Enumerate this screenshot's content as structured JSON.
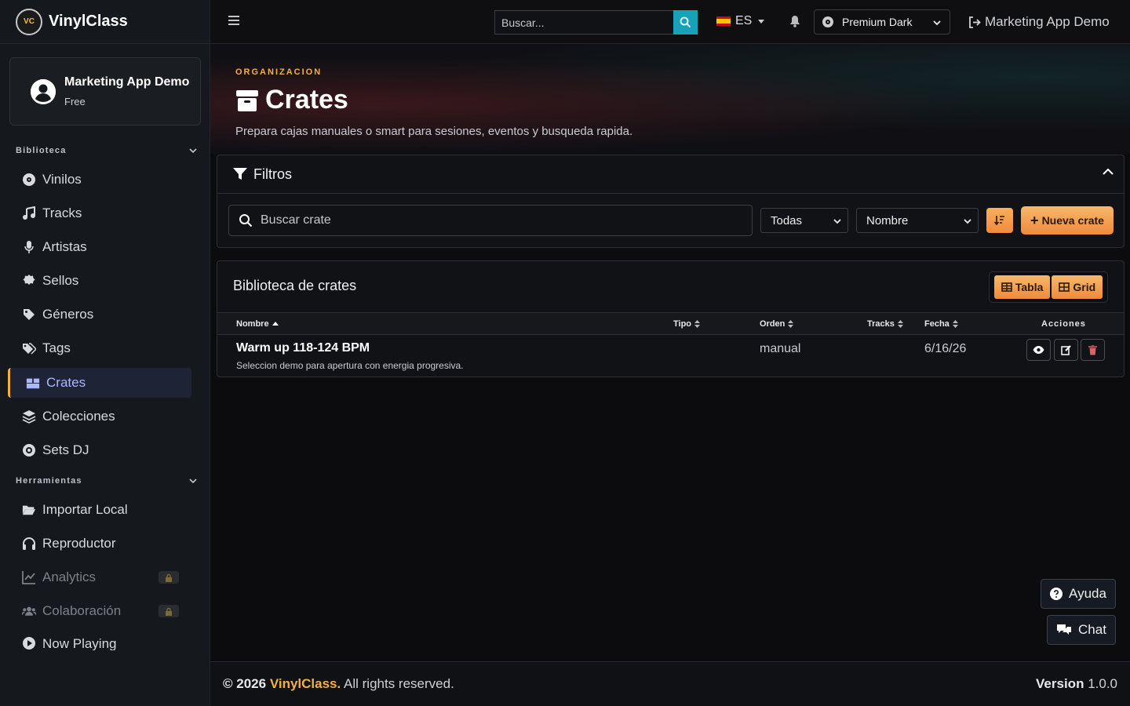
{
  "app": {
    "name": "VinylClass",
    "logo_text": "VC"
  },
  "user": {
    "name": "Marketing App Demo",
    "plan": "Free"
  },
  "sidebar": {
    "sections": [
      {
        "label": "Biblioteca"
      },
      {
        "label": "Herramientas"
      }
    ],
    "items": [
      {
        "label": "Vinilos",
        "icon": "disc-icon"
      },
      {
        "label": "Tracks",
        "icon": "music-note-icon"
      },
      {
        "label": "Artistas",
        "icon": "microphone-icon"
      },
      {
        "label": "Sellos",
        "icon": "badge-icon"
      },
      {
        "label": "Géneros",
        "icon": "tag-icon"
      },
      {
        "label": "Tags",
        "icon": "tags-icon"
      },
      {
        "label": "Crates",
        "icon": "boxes-icon",
        "active": true
      },
      {
        "label": "Colecciones",
        "icon": "layers-icon"
      },
      {
        "label": "Sets DJ",
        "icon": "record-icon"
      },
      {
        "label": "Importar Local",
        "icon": "folder-open-icon"
      },
      {
        "label": "Reproductor",
        "icon": "headphones-icon"
      },
      {
        "label": "Analytics",
        "icon": "chart-line-icon",
        "locked": true
      },
      {
        "label": "Colaboración",
        "icon": "users-icon",
        "locked": true
      },
      {
        "label": "Now Playing",
        "icon": "play-circle-icon"
      }
    ]
  },
  "header": {
    "search_placeholder": "Buscar...",
    "language": "ES",
    "theme": "Premium Dark",
    "account": "Marketing App Demo"
  },
  "page": {
    "eyebrow": "ORGANIZACION",
    "title": "Crates",
    "subtitle": "Prepara cajas manuales o smart para sesiones, eventos y busqueda rapida."
  },
  "filters": {
    "title": "Filtros",
    "search_placeholder": "Buscar crate",
    "type_select": "Todas",
    "sort_select": "Nombre",
    "new_button": "Nueva crate"
  },
  "library": {
    "title": "Biblioteca de crates",
    "view_table": "Tabla",
    "view_grid": "Grid",
    "columns": [
      "Nombre",
      "Tipo",
      "Orden",
      "Tracks",
      "Fecha",
      "Acciones"
    ],
    "rows": [
      {
        "name": "Warm up 118-124 BPM",
        "description": "Seleccion demo para apertura con energia progresiva.",
        "tipo": "",
        "orden": "manual",
        "tracks": "",
        "fecha": "6/16/26"
      }
    ]
  },
  "floating": {
    "help": "Ayuda",
    "chat": "Chat"
  },
  "footer": {
    "copyright": "© 2026",
    "brand": "VinylClass.",
    "rights": "All rights reserved.",
    "version_label": "Version",
    "version": "1.0.0"
  },
  "colors": {
    "accent": "#f5b041",
    "cyan": "#17a2b8",
    "active_nav": "#a9b8ff"
  }
}
